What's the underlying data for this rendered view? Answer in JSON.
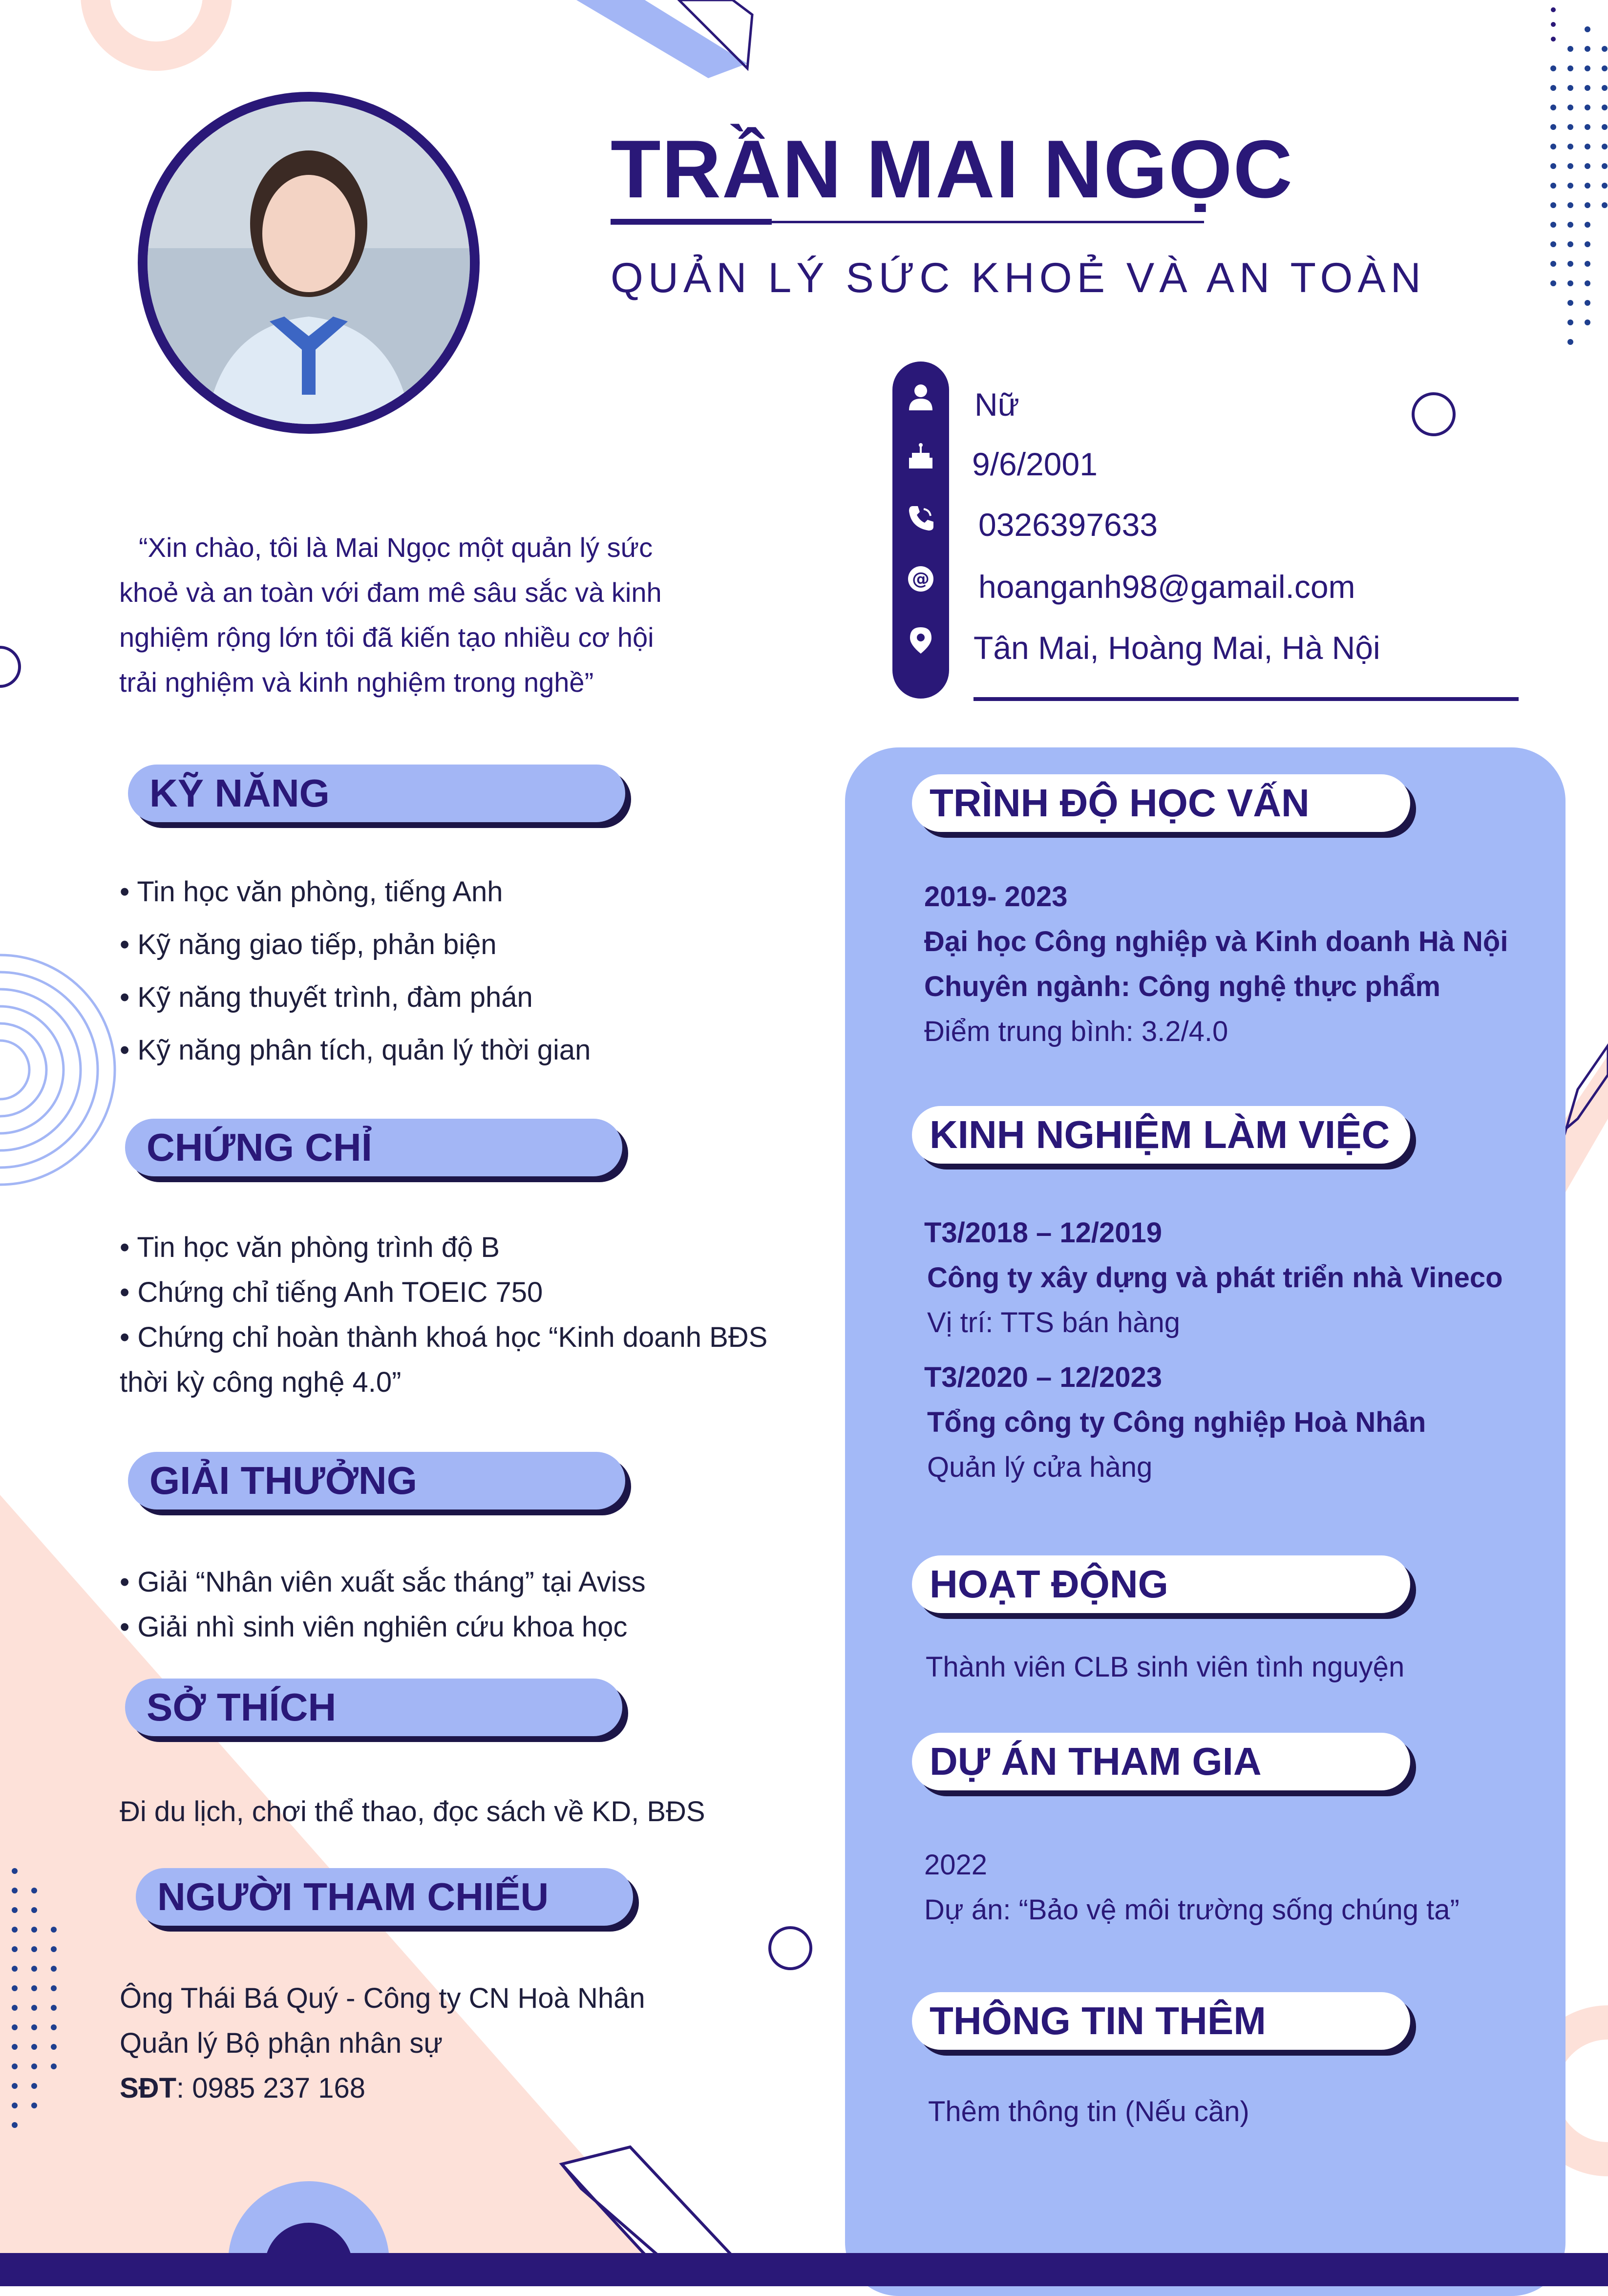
{
  "header": {
    "name": "TRẦN MAI NGỌC",
    "job_title": "QUẢN LÝ SỨC KHOẺ VÀ AN TOÀN"
  },
  "contact": {
    "gender": "Nữ",
    "birthday": "9/6/2001",
    "phone": "0326397633",
    "email": "hoanganh98@gamail.com",
    "address": "Tân Mai, Hoàng Mai, Hà Nội",
    "icons": [
      "person-icon",
      "cake-icon",
      "phone-icon",
      "at-icon",
      "location-icon"
    ]
  },
  "intro": {
    "lines": [
      "“Xin chào, tôi là Mai Ngọc một quản lý sức",
      "khoẻ và an toàn với đam mê sâu sắc và kinh",
      "nghiệm rộng lớn tôi đã kiến tạo nhiều cơ hội",
      "trải nghiệm và kinh nghiệm trong nghề”"
    ]
  },
  "skills": {
    "heading": "KỸ NĂNG",
    "items": [
      "• Tin học văn phòng, tiếng Anh",
      "• Kỹ năng giao tiếp, phản biện",
      "• Kỹ năng thuyết trình, đàm phán",
      "• Kỹ năng phân tích, quản lý thời gian"
    ]
  },
  "certificates": {
    "heading": "CHỨNG CHỈ",
    "items": [
      "• Tin học văn phòng trình độ B",
      "• Chứng chỉ tiếng Anh TOEIC 750",
      "• Chứng chỉ hoàn thành khoá học “Kinh doanh BĐS",
      "thời kỳ công nghệ 4.0”"
    ]
  },
  "awards": {
    "heading": "GIẢI THƯỞNG",
    "items": [
      "• Giải “Nhân viên xuất sắc tháng” tại Aviss",
      "• Giải nhì sinh viên nghiên cứu khoa học"
    ]
  },
  "hobbies": {
    "heading": "SỞ THÍCH",
    "text": "Đi du lịch, chơi thể thao, đọc sách về KD, BĐS"
  },
  "reference": {
    "heading": "NGƯỜI THAM CHIẾU",
    "line1": "Ông Thái Bá Quý - Công ty CN Hoà Nhân",
    "line2": "Quản lý Bộ phận nhân sự",
    "phone_label": "SĐT",
    "phone_value": ": 0985 237 168"
  },
  "education": {
    "heading": "TRÌNH ĐỘ HỌC VẤN",
    "years": "2019- 2023",
    "school": "Đại học Công nghiệp và Kinh doanh Hà Nội",
    "major": "Chuyên ngành: Công nghệ thực phẩm",
    "gpa": "Điểm trung bình: 3.2/4.0"
  },
  "experience": {
    "heading": "KINH NGHIỆM LÀM VIỆC",
    "jobs": [
      {
        "period": "T3/2018 – 12/2019",
        "company": "Công ty xây dựng và phát triển nhà Vineco",
        "role": "Vị trí: TTS bán hàng"
      },
      {
        "period": "T3/2020 – 12/2023",
        "company": "Tổng công ty Công nghiệp Hoà Nhân",
        "role": "Quản lý cửa hàng"
      }
    ]
  },
  "activities": {
    "heading": "HOẠT ĐỘNG",
    "text": "Thành viên CLB sinh viên tình nguyện"
  },
  "projects": {
    "heading": "DỰ ÁN THAM GIA",
    "year": "2022",
    "text": "Dự án: “Bảo vệ môi trường sống chúng ta”"
  },
  "extra": {
    "heading": "THÔNG TIN THÊM",
    "text": "Thêm thông tin (Nếu cần)"
  },
  "colors": {
    "primary": "#2a1878",
    "accent_blue": "#a3b9f7",
    "peach": "#fde1d9",
    "shadow": "#1c1547"
  }
}
